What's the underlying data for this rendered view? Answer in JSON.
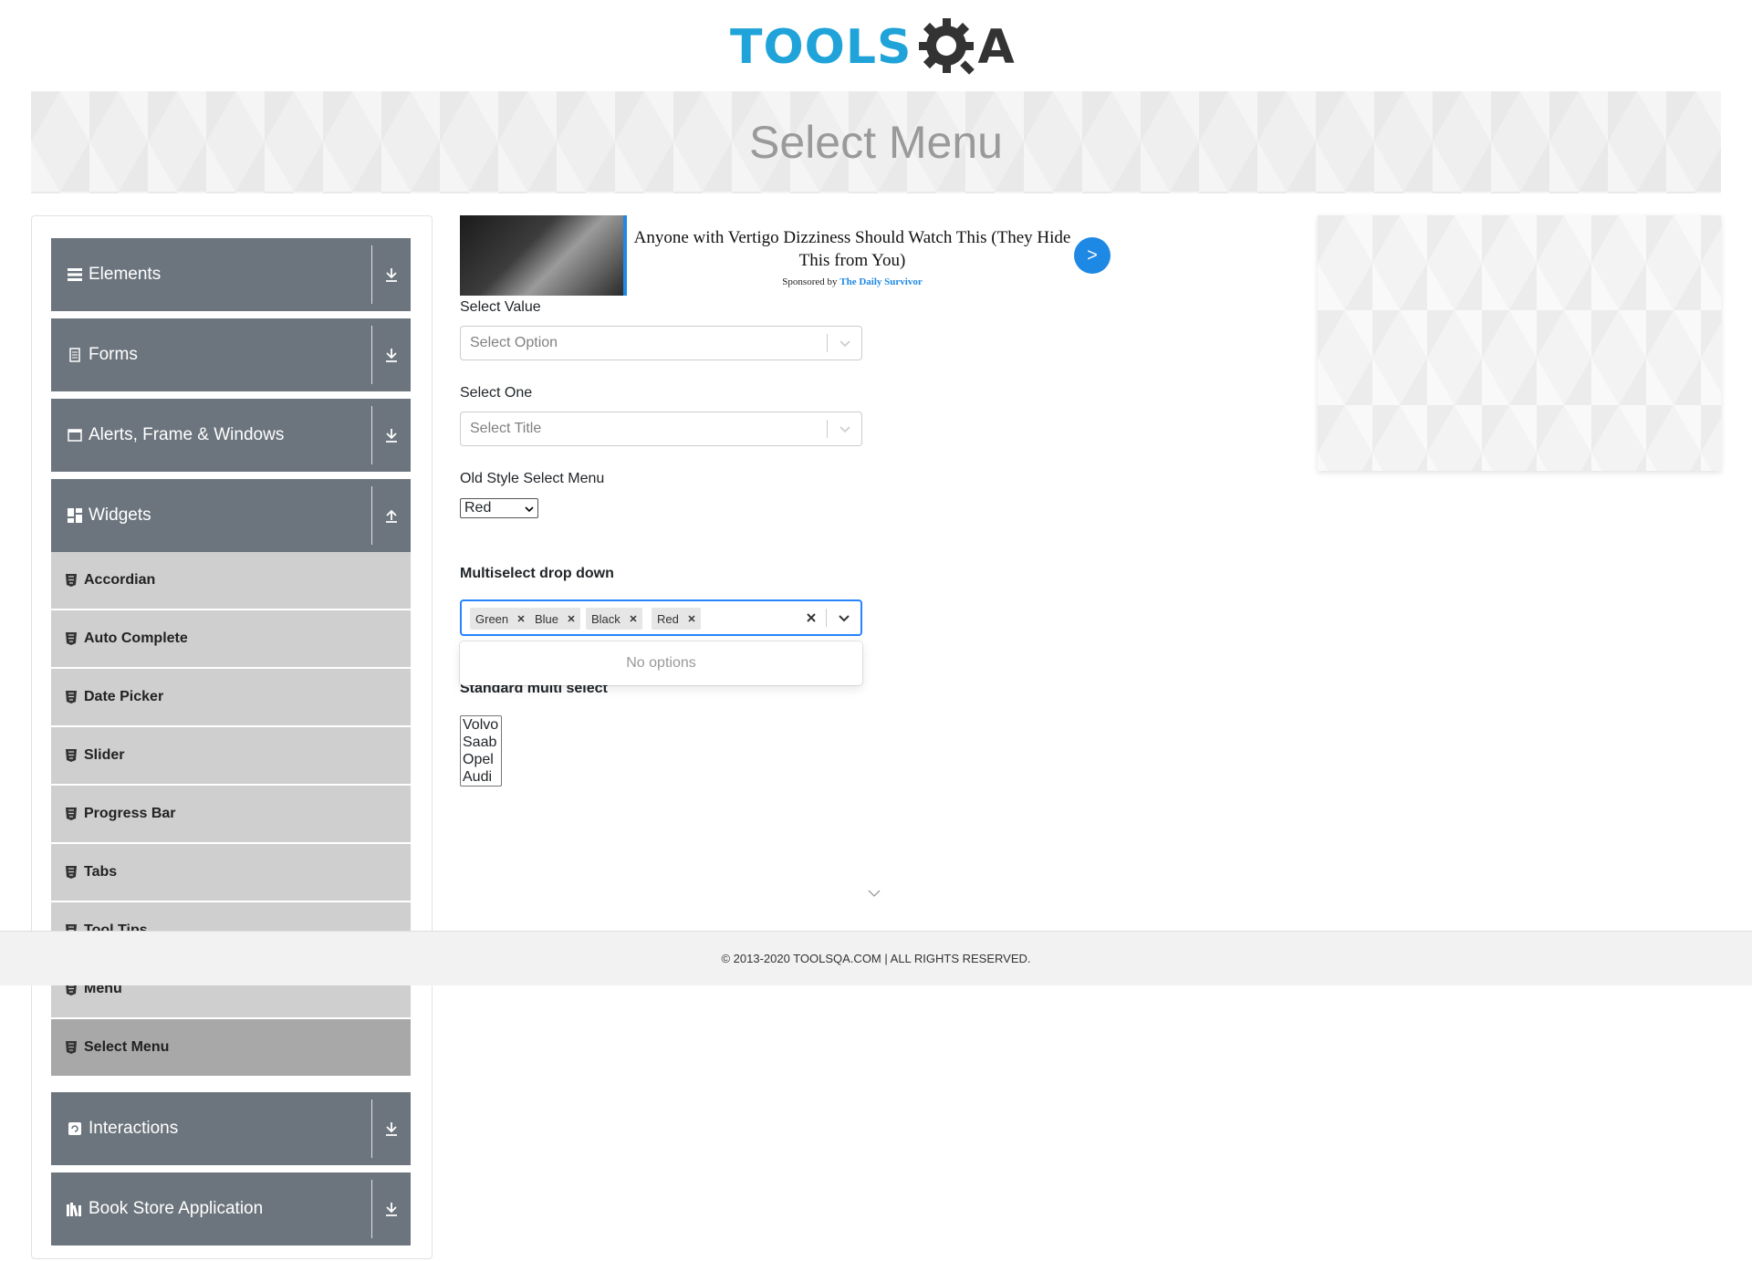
{
  "logo": {
    "part1": "TOOLS",
    "part2": "A"
  },
  "banner": {
    "title": "Select Menu"
  },
  "sidebar": {
    "groups": [
      {
        "label": "Elements",
        "icon": "list-icon"
      },
      {
        "label": "Forms",
        "icon": "document-icon"
      },
      {
        "label": "Alerts, Frame & Windows",
        "icon": "window-icon"
      },
      {
        "label": "Widgets",
        "icon": "dashboard-icon"
      },
      {
        "label": "Interactions",
        "icon": "refresh-icon"
      },
      {
        "label": "Book Store Application",
        "icon": "books-icon"
      }
    ],
    "widget_items": [
      "Accordian",
      "Auto Complete",
      "Date Picker",
      "Slider",
      "Progress Bar",
      "Tabs",
      "Tool Tips",
      "Menu",
      "Select Menu"
    ],
    "active_item": "Select Menu"
  },
  "ad": {
    "title": "Anyone with Vertigo Dizziness Should Watch This (They Hide This from You)",
    "sponsored_prefix": "Sponsored by",
    "sponsor": "The Daily Survivor",
    "button": ">"
  },
  "form": {
    "select_value": {
      "label": "Select Value",
      "placeholder": "Select Option"
    },
    "select_one": {
      "label": "Select One",
      "placeholder": "Select Title"
    },
    "old_style": {
      "label": "Old Style Select Menu",
      "value": "Red"
    },
    "multiselect": {
      "label": "Multiselect drop down",
      "chips": [
        "Green",
        "Blue",
        "Black",
        "Red"
      ],
      "menu_text": "No options"
    },
    "standard_multi": {
      "label": "Standard multi select",
      "options": [
        "Volvo",
        "Saab",
        "Opel",
        "Audi"
      ]
    }
  },
  "footer": {
    "text": "© 2013-2020 TOOLSQA.COM | ALL RIGHTS RESERVED."
  },
  "colors": {
    "brand_blue": "#1fa3d9",
    "sidebar_header": "#6c757d",
    "focus_blue": "#2684ff",
    "ad_button": "#1e88e5"
  }
}
